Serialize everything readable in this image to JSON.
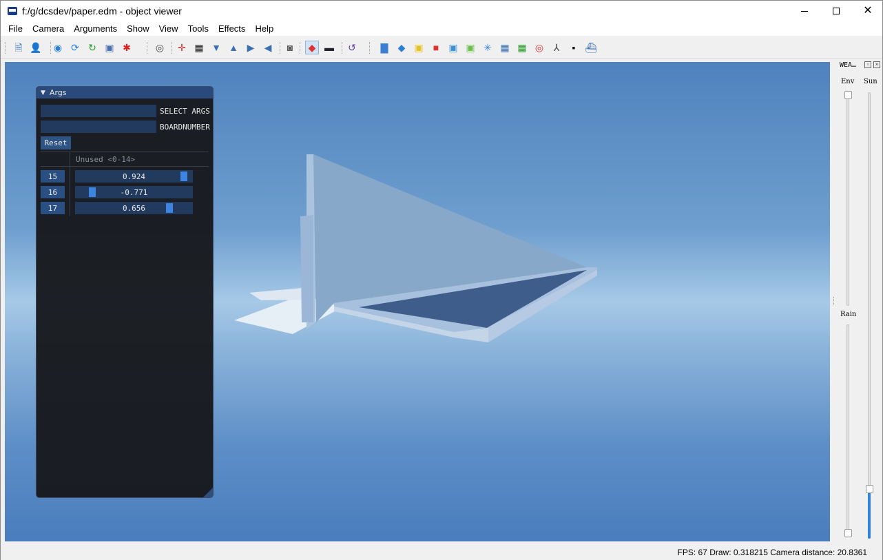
{
  "window": {
    "title": "f:/g/dcsdev/paper.edm - object viewer",
    "minimize_icon": "minimize-icon",
    "maximize_icon": "maximize-icon",
    "close_glyph": "✕"
  },
  "menu": {
    "items": [
      "File",
      "Camera",
      "Arguments",
      "Show",
      "View",
      "Tools",
      "Effects",
      "Help"
    ]
  },
  "toolbar": {
    "buttons": [
      {
        "icon": "open-file-icon",
        "glyph": "🗎",
        "color": "#3a6fb0"
      },
      {
        "icon": "add-user-icon",
        "glyph": "👤",
        "color": "#333"
      },
      {
        "icon": "globe-icon",
        "glyph": "◉",
        "color": "#2a7fd4"
      },
      {
        "icon": "reload-icon",
        "glyph": "⟳",
        "color": "#2a7fd4"
      },
      {
        "icon": "refresh-green-icon",
        "glyph": "↻",
        "color": "#2a9a2a"
      },
      {
        "icon": "picture-icon",
        "glyph": "▣",
        "color": "#4a6fb5"
      },
      {
        "icon": "runner-icon",
        "glyph": "✱",
        "color": "#d22"
      },
      {
        "icon": "camera-icon",
        "glyph": "◎",
        "color": "#444"
      },
      {
        "icon": "crosshair-icon",
        "glyph": "✛",
        "color": "#c33"
      },
      {
        "icon": "frame-icon",
        "glyph": "▦",
        "color": "#222"
      },
      {
        "icon": "funnel-icon",
        "glyph": "▼",
        "color": "#3a6fb0"
      },
      {
        "icon": "cone-icon",
        "glyph": "▲",
        "color": "#3a6fb0"
      },
      {
        "icon": "arrow-right-icon",
        "glyph": "▶",
        "color": "#3a6fb0"
      },
      {
        "icon": "arrow-left-icon",
        "glyph": "◀",
        "color": "#3a6fb0"
      },
      {
        "icon": "texture-icon",
        "glyph": "◙",
        "color": "#555"
      },
      {
        "icon": "color-cube-icon",
        "glyph": "◆",
        "color": "#d33"
      },
      {
        "icon": "film-icon",
        "glyph": "▬",
        "color": "#223"
      },
      {
        "icon": "undo-icon",
        "glyph": "↺",
        "color": "#5a3fa0"
      },
      {
        "icon": "bar-chart-icon",
        "glyph": "▇",
        "color": "#3a7fd4"
      },
      {
        "icon": "blue-box-icon",
        "glyph": "◆",
        "color": "#2a7fd4"
      },
      {
        "icon": "yellow-boxes-icon",
        "glyph": "▣",
        "color": "#e8c020"
      },
      {
        "icon": "red-cube-icon",
        "glyph": "■",
        "color": "#d33"
      },
      {
        "icon": "blue-cube-icon",
        "glyph": "▣",
        "color": "#3a8fd4"
      },
      {
        "icon": "green-cube-icon",
        "glyph": "▣",
        "color": "#6ac04a"
      },
      {
        "icon": "atom-icon",
        "glyph": "✳",
        "color": "#3a7fd4"
      },
      {
        "icon": "grid-icon",
        "glyph": "▦",
        "color": "#3a6fb0"
      },
      {
        "icon": "green-grid-icon",
        "glyph": "▦",
        "color": "#2a9a2a"
      },
      {
        "icon": "target-icon",
        "glyph": "◎",
        "color": "#d33"
      },
      {
        "icon": "axes-icon",
        "glyph": "⅄",
        "color": "#444"
      },
      {
        "icon": "terminal-icon",
        "glyph": "▪",
        "color": "#111"
      },
      {
        "icon": "ship-icon",
        "glyph": "⛴",
        "color": "#3a6fb0"
      }
    ]
  },
  "args_panel": {
    "title": "Args",
    "select_label": "SELECT ARGS",
    "board_label": "BOARDNUMBER",
    "reset_label": "Reset",
    "unused_label": "Unused <0-14>",
    "rows": [
      {
        "arg": "15",
        "value": "0.924",
        "level": 0.924
      },
      {
        "arg": "16",
        "value": "-0.771",
        "level": -0.771
      },
      {
        "arg": "17",
        "value": "0.656",
        "level": 0.656
      }
    ]
  },
  "weather": {
    "title": "WEA…",
    "env_label": "Env",
    "sun_label": "Sun",
    "rain_label": "Rain"
  },
  "status": {
    "text": "FPS: 67  Draw: 0.318215  Camera distance: 20.8361"
  },
  "colors": {
    "accent": "#3d84e0",
    "panel_header": "#294a7a",
    "sky_top": "#4f82bd",
    "horizon": "#a6c9e6"
  }
}
